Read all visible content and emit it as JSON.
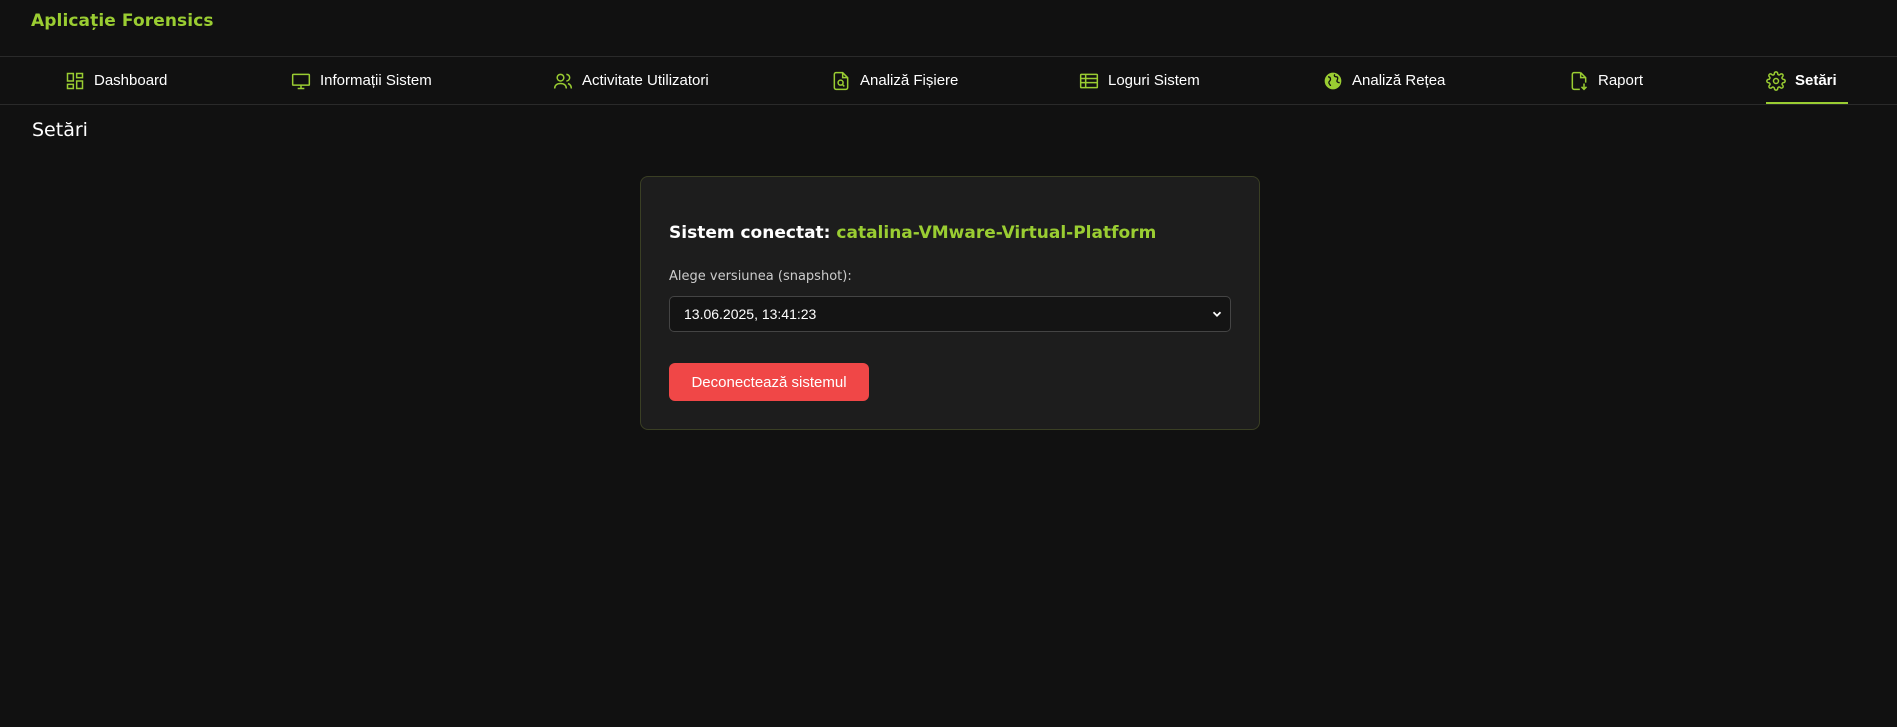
{
  "app": {
    "title": "Aplicație Forensics",
    "accent_color": "#9acd32",
    "danger_color": "#f04747"
  },
  "nav": {
    "items": [
      {
        "label": "Dashboard",
        "icon": "dashboard-icon"
      },
      {
        "label": "Informații Sistem",
        "icon": "monitor-icon"
      },
      {
        "label": "Activitate Utilizatori",
        "icon": "users-icon"
      },
      {
        "label": "Analiză Fișiere",
        "icon": "file-search-icon"
      },
      {
        "label": "Loguri Sistem",
        "icon": "table-icon"
      },
      {
        "label": "Analiză Rețea",
        "icon": "globe-icon"
      },
      {
        "label": "Raport",
        "icon": "file-download-icon"
      },
      {
        "label": "Setări",
        "icon": "gear-icon",
        "active": true
      }
    ]
  },
  "page": {
    "title": "Setări"
  },
  "settings": {
    "connected_label": "Sistem conectat:",
    "connected_system": "catalina-VMware-Virtual-Platform",
    "snapshot_label": "Alege versiunea (snapshot):",
    "snapshot_selected": "13.06.2025, 13:41:23",
    "disconnect_label": "Deconectează sistemul"
  }
}
